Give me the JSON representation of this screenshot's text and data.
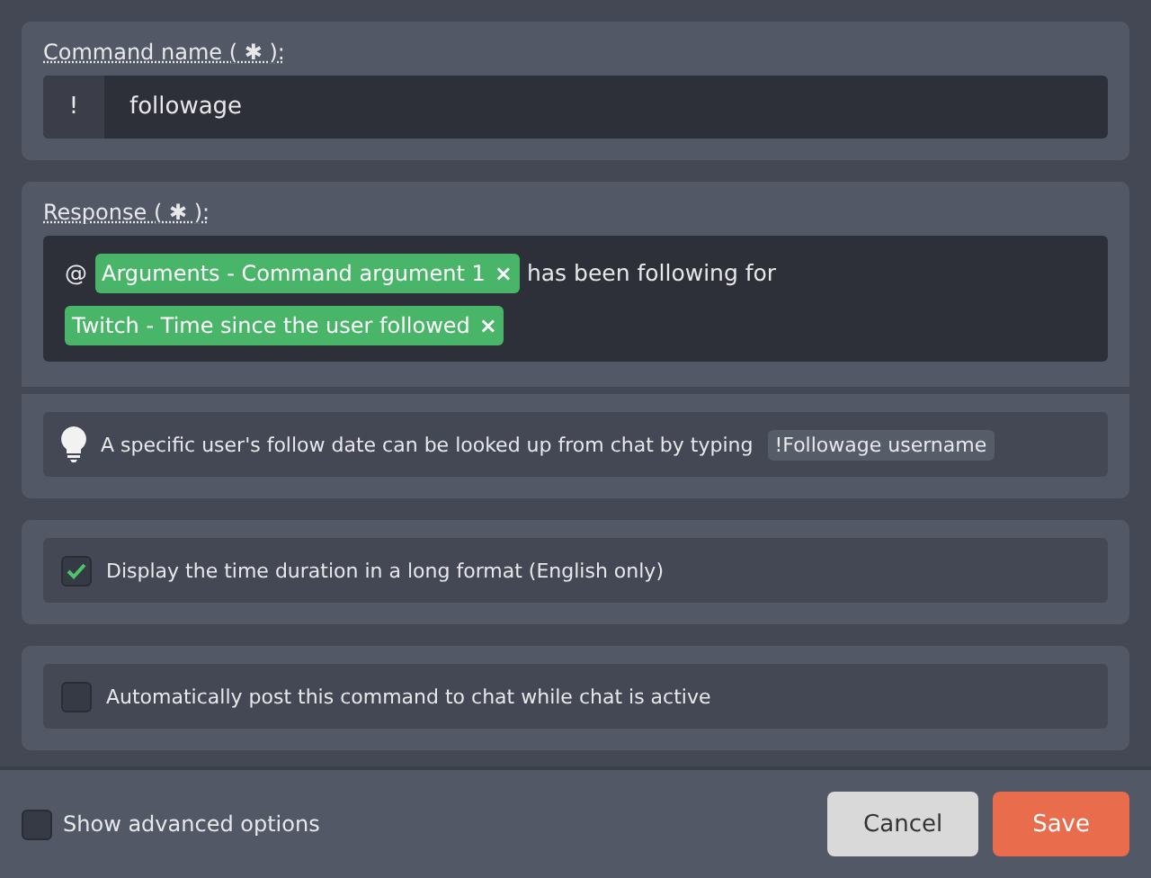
{
  "command": {
    "label": "Command name ( ✱ ):",
    "prefix": "!",
    "value": "followage"
  },
  "response": {
    "label": "Response ( ✱ ):",
    "segments": [
      {
        "kind": "text",
        "text": "@"
      },
      {
        "kind": "tag",
        "text": "Arguments - Command argument 1",
        "remove": "×"
      },
      {
        "kind": "text",
        "text": "has been following for"
      },
      {
        "kind": "tag",
        "text": "Twitch - Time since the user followed",
        "remove": "×"
      }
    ]
  },
  "tip": {
    "text": "A specific user's follow date can be looked up from chat by typing",
    "code": "!Followage username"
  },
  "options": [
    {
      "label": "Display the time duration in a long format (English only)",
      "checked": true
    },
    {
      "label": "Automatically post this command to chat while chat is active",
      "checked": false
    }
  ],
  "footer": {
    "advanced": {
      "label": "Show advanced options",
      "checked": false
    },
    "buttons": [
      {
        "label": "Cancel",
        "kind": "secondary"
      },
      {
        "label": "Save",
        "kind": "primary"
      }
    ]
  }
}
